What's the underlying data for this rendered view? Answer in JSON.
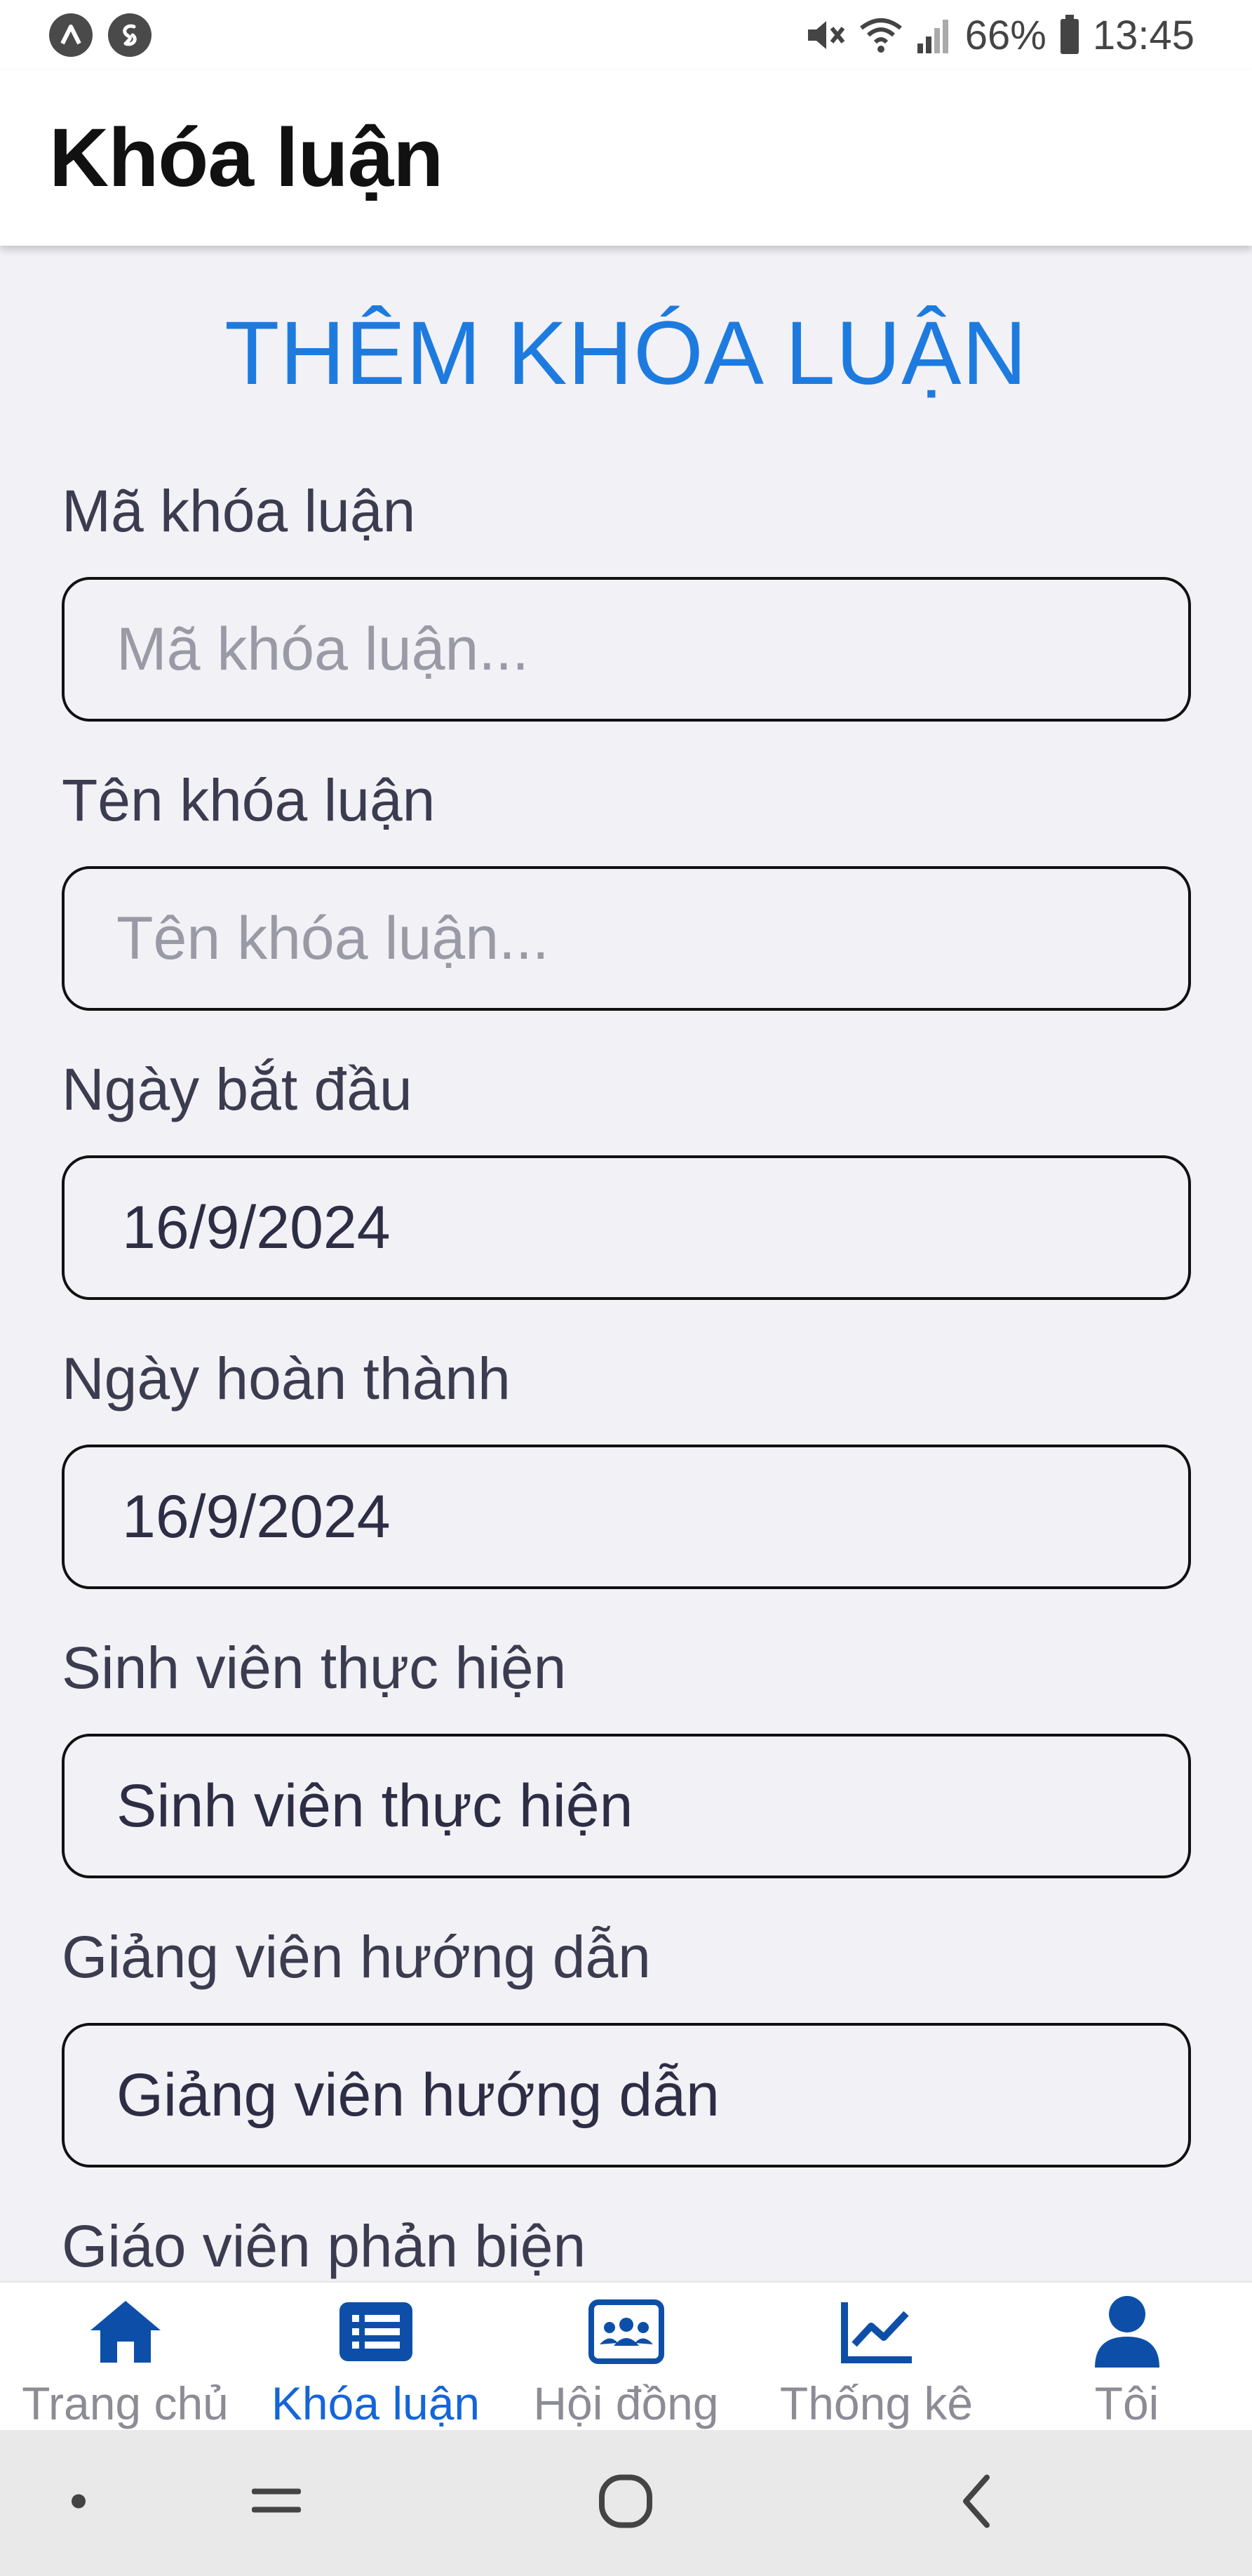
{
  "status_bar": {
    "battery": "66%",
    "time": "13:45",
    "left_icons": [
      "a-circle-icon",
      "shazam-icon"
    ],
    "right_icons": [
      "mute-icon",
      "wifi-icon",
      "signal-icon",
      "battery-icon"
    ]
  },
  "header": {
    "title": "Khóa luận"
  },
  "form": {
    "title": "THÊM KHÓA LUẬN",
    "fields": [
      {
        "label": "Mã khóa luận",
        "placeholder": "Mã khóa luận...",
        "value": ""
      },
      {
        "label": "Tên khóa luận",
        "placeholder": "Tên khóa luận...",
        "value": ""
      },
      {
        "label": "Ngày bắt đầu",
        "value": "16/9/2024"
      },
      {
        "label": "Ngày hoàn thành",
        "value": "16/9/2024"
      },
      {
        "label": "Sinh viên thực hiện",
        "value": "Sinh viên thực hiện"
      },
      {
        "label": "Giảng viên hướng dẫn",
        "value": "Giảng viên hướng dẫn"
      },
      {
        "label": "Giáo viên phản biện"
      }
    ]
  },
  "bottom_nav": {
    "items": [
      {
        "label": "Trang chủ",
        "icon": "home-icon"
      },
      {
        "label": "Khóa luận",
        "icon": "list-icon",
        "active": true
      },
      {
        "label": "Hội đồng",
        "icon": "group-icon"
      },
      {
        "label": "Thống kê",
        "icon": "chart-icon"
      },
      {
        "label": "Tôi",
        "icon": "person-icon"
      }
    ]
  },
  "colors": {
    "accent": "#1d7be0",
    "nav_active": "#1565d8",
    "nav_icon": "#0d4fa8",
    "nav_inactive_text": "#8c8c96"
  }
}
